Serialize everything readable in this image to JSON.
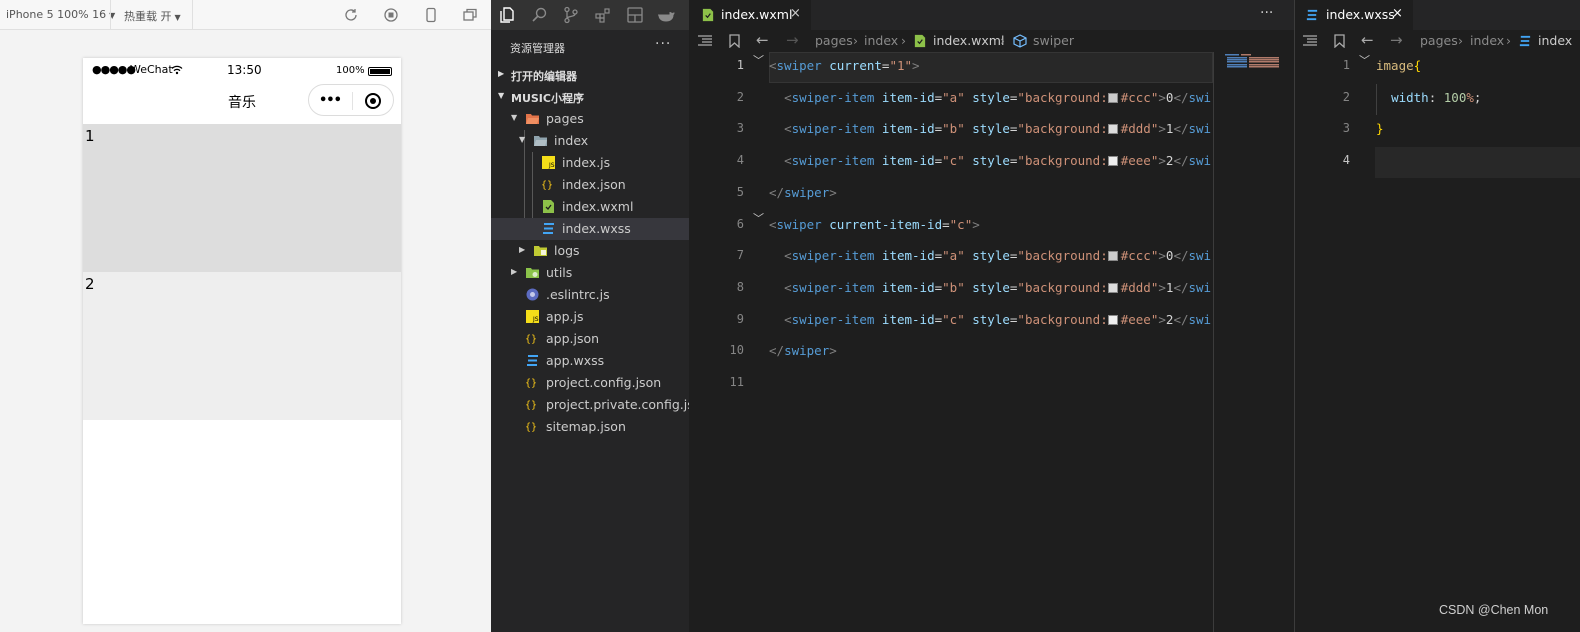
{
  "simulator": {
    "device_label": "iPhone 5 100% 16",
    "hot_reload_label": "热重载 开",
    "status": {
      "signal": "●●●●●",
      "carrier": "WeChat",
      "time": "13:50",
      "battery": "100%"
    },
    "nav_title": "音乐",
    "capsule_dots": "•••",
    "swiper_items": [
      {
        "text": "1",
        "color": "#dddddd"
      },
      {
        "text": "2",
        "color": "#eeeeee"
      }
    ]
  },
  "explorer": {
    "title": "资源管理器",
    "more": "···",
    "open_editors_label": "打开的编辑器",
    "project_label": "MUSIC小程序",
    "tree": [
      {
        "name": "pages",
        "icon": "folder-open-icon"
      },
      {
        "name": "index",
        "icon": "folder-open-icon"
      },
      {
        "name": "index.js",
        "icon": "js-file-icon"
      },
      {
        "name": "index.json",
        "icon": "json-file-icon"
      },
      {
        "name": "index.wxml",
        "icon": "wxml-file-icon"
      },
      {
        "name": "index.wxss",
        "icon": "wxss-file-icon"
      },
      {
        "name": "logs",
        "icon": "folder-icon"
      },
      {
        "name": "utils",
        "icon": "folder-icon"
      },
      {
        "name": ".eslintrc.js",
        "icon": "eslint-file-icon"
      },
      {
        "name": "app.js",
        "icon": "js-file-icon"
      },
      {
        "name": "app.json",
        "icon": "json-file-icon"
      },
      {
        "name": "app.wxss",
        "icon": "wxss-file-icon"
      },
      {
        "name": "project.config.json",
        "icon": "json-file-icon"
      },
      {
        "name": "project.private.config.js...",
        "icon": "json-file-icon"
      },
      {
        "name": "sitemap.json",
        "icon": "json-file-icon"
      }
    ]
  },
  "editor1": {
    "tab_label": "index.wxml",
    "tab_close": "×",
    "more": "···",
    "breadcrumb": [
      "pages",
      "index",
      "index.wxml",
      "swiper"
    ],
    "line_numbers": [
      "1",
      "2",
      "3",
      "4",
      "5",
      "6",
      "7",
      "8",
      "9",
      "10",
      "11"
    ],
    "lines": [
      {
        "parts": [
          [
            "t-punc",
            "<"
          ],
          [
            "t-tag",
            "swiper"
          ],
          [
            "t-txt",
            " "
          ],
          [
            "t-attr",
            "current"
          ],
          [
            "t-txt",
            "="
          ],
          [
            "t-str",
            "\"1\""
          ],
          [
            "t-punc",
            ">"
          ]
        ]
      },
      {
        "parts": [
          [
            "t-txt",
            "  "
          ],
          [
            "t-punc",
            "<"
          ],
          [
            "t-tag",
            "swiper-item"
          ],
          [
            "t-txt",
            " "
          ],
          [
            "t-attr",
            "item-id"
          ],
          [
            "t-txt",
            "="
          ],
          [
            "t-str",
            "\"a\""
          ],
          [
            "t-txt",
            " "
          ],
          [
            "t-attr",
            "style"
          ],
          [
            "t-txt",
            "="
          ],
          [
            "t-str",
            "\"background:"
          ],
          [
            "swatch",
            "#cccccc"
          ],
          [
            "t-str",
            "#ccc\""
          ],
          [
            "t-punc",
            ">"
          ],
          [
            "t-txt",
            "0"
          ],
          [
            "t-punc",
            "</"
          ],
          [
            "t-tag",
            "swi"
          ]
        ]
      },
      {
        "parts": [
          [
            "t-txt",
            "  "
          ],
          [
            "t-punc",
            "<"
          ],
          [
            "t-tag",
            "swiper-item"
          ],
          [
            "t-txt",
            " "
          ],
          [
            "t-attr",
            "item-id"
          ],
          [
            "t-txt",
            "="
          ],
          [
            "t-str",
            "\"b\""
          ],
          [
            "t-txt",
            " "
          ],
          [
            "t-attr",
            "style"
          ],
          [
            "t-txt",
            "="
          ],
          [
            "t-str",
            "\"background:"
          ],
          [
            "swatch",
            "#dddddd"
          ],
          [
            "t-str",
            "#ddd\""
          ],
          [
            "t-punc",
            ">"
          ],
          [
            "t-txt",
            "1"
          ],
          [
            "t-punc",
            "</"
          ],
          [
            "t-tag",
            "swi"
          ]
        ]
      },
      {
        "parts": [
          [
            "t-txt",
            "  "
          ],
          [
            "t-punc",
            "<"
          ],
          [
            "t-tag",
            "swiper-item"
          ],
          [
            "t-txt",
            " "
          ],
          [
            "t-attr",
            "item-id"
          ],
          [
            "t-txt",
            "="
          ],
          [
            "t-str",
            "\"c\""
          ],
          [
            "t-txt",
            " "
          ],
          [
            "t-attr",
            "style"
          ],
          [
            "t-txt",
            "="
          ],
          [
            "t-str",
            "\"background:"
          ],
          [
            "swatch",
            "#eeeeee"
          ],
          [
            "t-str",
            "#eee\""
          ],
          [
            "t-punc",
            ">"
          ],
          [
            "t-txt",
            "2"
          ],
          [
            "t-punc",
            "</"
          ],
          [
            "t-tag",
            "swi"
          ]
        ]
      },
      {
        "parts": [
          [
            "t-punc",
            "</"
          ],
          [
            "t-tag",
            "swiper"
          ],
          [
            "t-punc",
            ">"
          ]
        ]
      },
      {
        "parts": [
          [
            "t-punc",
            "<"
          ],
          [
            "t-tag",
            "swiper"
          ],
          [
            "t-txt",
            " "
          ],
          [
            "t-attr",
            "current-item-id"
          ],
          [
            "t-txt",
            "="
          ],
          [
            "t-str",
            "\"c\""
          ],
          [
            "t-punc",
            ">"
          ]
        ]
      },
      {
        "parts": [
          [
            "t-txt",
            "  "
          ],
          [
            "t-punc",
            "<"
          ],
          [
            "t-tag",
            "swiper-item"
          ],
          [
            "t-txt",
            " "
          ],
          [
            "t-attr",
            "item-id"
          ],
          [
            "t-txt",
            "="
          ],
          [
            "t-str",
            "\"a\""
          ],
          [
            "t-txt",
            " "
          ],
          [
            "t-attr",
            "style"
          ],
          [
            "t-txt",
            "="
          ],
          [
            "t-str",
            "\"background:"
          ],
          [
            "swatch",
            "#cccccc"
          ],
          [
            "t-str",
            "#ccc\""
          ],
          [
            "t-punc",
            ">"
          ],
          [
            "t-txt",
            "0"
          ],
          [
            "t-punc",
            "</"
          ],
          [
            "t-tag",
            "swi"
          ]
        ]
      },
      {
        "parts": [
          [
            "t-txt",
            "  "
          ],
          [
            "t-punc",
            "<"
          ],
          [
            "t-tag",
            "swiper-item"
          ],
          [
            "t-txt",
            " "
          ],
          [
            "t-attr",
            "item-id"
          ],
          [
            "t-txt",
            "="
          ],
          [
            "t-str",
            "\"b\""
          ],
          [
            "t-txt",
            " "
          ],
          [
            "t-attr",
            "style"
          ],
          [
            "t-txt",
            "="
          ],
          [
            "t-str",
            "\"background:"
          ],
          [
            "swatch",
            "#dddddd"
          ],
          [
            "t-str",
            "#ddd\""
          ],
          [
            "t-punc",
            ">"
          ],
          [
            "t-txt",
            "1"
          ],
          [
            "t-punc",
            "</"
          ],
          [
            "t-tag",
            "swi"
          ]
        ]
      },
      {
        "parts": [
          [
            "t-txt",
            "  "
          ],
          [
            "t-punc",
            "<"
          ],
          [
            "t-tag",
            "swiper-item"
          ],
          [
            "t-txt",
            " "
          ],
          [
            "t-attr",
            "item-id"
          ],
          [
            "t-txt",
            "="
          ],
          [
            "t-str",
            "\"c\""
          ],
          [
            "t-txt",
            " "
          ],
          [
            "t-attr",
            "style"
          ],
          [
            "t-txt",
            "="
          ],
          [
            "t-str",
            "\"background:"
          ],
          [
            "swatch",
            "#eeeeee"
          ],
          [
            "t-str",
            "#eee\""
          ],
          [
            "t-punc",
            ">"
          ],
          [
            "t-txt",
            "2"
          ],
          [
            "t-punc",
            "</"
          ],
          [
            "t-tag",
            "swi"
          ]
        ]
      },
      {
        "parts": [
          [
            "t-punc",
            "</"
          ],
          [
            "t-tag",
            "swiper"
          ],
          [
            "t-punc",
            ">"
          ]
        ]
      },
      {
        "parts": []
      }
    ]
  },
  "editor2": {
    "tab_label": "index.wxss",
    "tab_close": "×",
    "breadcrumb": [
      "pages",
      "index",
      "index"
    ],
    "line_numbers": [
      "1",
      "2",
      "3",
      "4"
    ],
    "lines": [
      {
        "parts": [
          [
            "t-sel",
            "image"
          ],
          [
            "t-brace",
            "{"
          ]
        ]
      },
      {
        "parts": [
          [
            "t-txt",
            "  "
          ],
          [
            "t-prop",
            "width"
          ],
          [
            "t-txt",
            ": "
          ],
          [
            "t-num",
            "100"
          ],
          [
            "t-unit",
            "%"
          ],
          [
            "t-txt",
            ";"
          ]
        ]
      },
      {
        "parts": [
          [
            "t-brace",
            "}"
          ]
        ]
      },
      {
        "parts": []
      }
    ]
  },
  "watermark": "CSDN @Chen Mon",
  "colors": {
    "accent_js": "#f5de19",
    "accent_json": "#f5c518",
    "accent_wxml": "#8dc149",
    "accent_wxss": "#42a5f5",
    "folder": "#dcb67a"
  }
}
